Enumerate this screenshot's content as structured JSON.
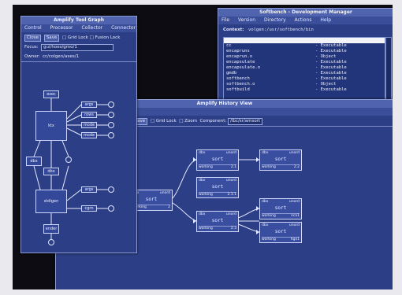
{
  "devmgr": {
    "title": "Softbench - Development Manager",
    "menu": [
      "File",
      "Version",
      "Directory",
      "Actions",
      "Help"
    ],
    "context_label": "Context:",
    "context_value": "volgen:/usr/softbench/bin",
    "files": [
      {
        "name": "",
        "kind": ""
      },
      {
        "name": "cc",
        "kind": "- Executable"
      },
      {
        "name": "encapruns",
        "kind": "- Executable"
      },
      {
        "name": "encaprun.o",
        "kind": "- Object"
      },
      {
        "name": "encapsulate",
        "kind": "- Executable"
      },
      {
        "name": "encapsulate.o",
        "kind": "- Executable"
      },
      {
        "name": "gmdb",
        "kind": "- Executable"
      },
      {
        "name": "softbench",
        "kind": "- Executable"
      },
      {
        "name": "softbench.o",
        "kind": "- Object"
      },
      {
        "name": "softbuild",
        "kind": "- Executable"
      }
    ]
  },
  "toolgraph": {
    "title": "Amplify Tool Graph",
    "menu": [
      "Control",
      "Processor",
      "Collector",
      "Connector"
    ],
    "buttons": [
      "Close",
      "Save"
    ],
    "checks": [
      "Grid Lock",
      "Fusion Lock"
    ],
    "focus_label": "Focus:",
    "focus_value": "gui/hoes/gmo/1",
    "owner_label": "Owner:",
    "owner_value": "cc/colgen/axes/1",
    "nodes": {
      "top": "exec",
      "main": "ktx",
      "left": "dbx",
      "mid": "dbx",
      "lower": "stdlgen",
      "bottom": "ender"
    },
    "context_rows": [
      "args",
      "rows",
      "mode",
      "mode",
      "args",
      "cgrn"
    ]
  },
  "history": {
    "title": "Amplify History View",
    "menu_partial": "rsion",
    "buttons": [
      "ge",
      "Save"
    ],
    "checks": [
      "Grid Lock",
      "Zoom"
    ],
    "component_label": "Component:",
    "component_value": "/ibc/sr/amsort",
    "boxes": [
      {
        "id": "root",
        "tl": "dbx",
        "tr": "unord",
        "name": "sort",
        "status": "working",
        "ver": "2"
      },
      {
        "id": "a",
        "tl": "dbx",
        "tr": "unord",
        "name": "sort",
        "status": "working",
        "ver": "2.1"
      },
      {
        "id": "b",
        "tl": "dbx",
        "tr": "unord",
        "name": "sort",
        "status": "working",
        "ver": "2.2"
      },
      {
        "id": "c",
        "tl": "dbx",
        "tr": "unord",
        "name": "sort",
        "status": "working",
        "ver": "2.1.1"
      },
      {
        "id": "d",
        "tl": "dbx",
        "tr": "unord",
        "name": "sort",
        "status": "working",
        "ver": "2.3"
      },
      {
        "id": "e",
        "tl": "dbx",
        "tr": "unord",
        "name": "sort",
        "status": "working",
        "ver": "ncx1"
      },
      {
        "id": "f",
        "tl": "dbx",
        "tr": "unord",
        "name": "sort",
        "status": "working",
        "ver": "hgx1"
      }
    ]
  }
}
